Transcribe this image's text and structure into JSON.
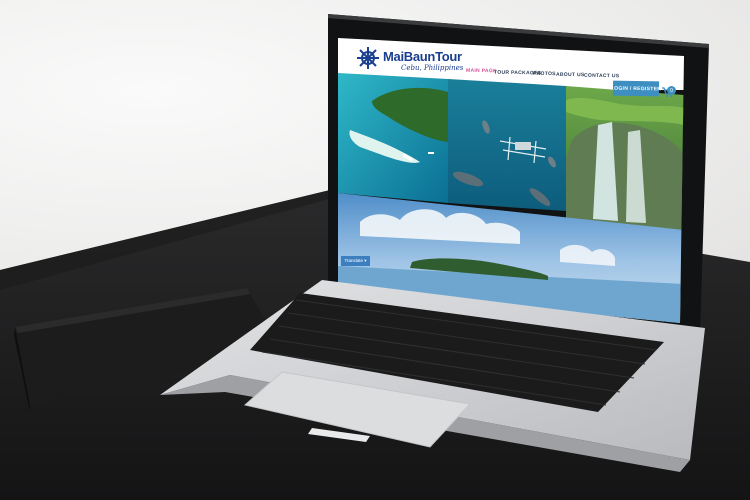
{
  "site": {
    "brand": "MaiBaunTour",
    "tagline": "Cebu, Philippines",
    "nav": {
      "main_page": "MAIN PAGE",
      "tour_packages": "TOUR PACKAGES",
      "photos": "PHOTOS",
      "about_us": "ABOUT US",
      "contact_us": "CONTACT US"
    },
    "login_label": "LOGIN / REGISTER",
    "cart_count": "0",
    "translate_label": "Translate ▾"
  },
  "colors": {
    "brand_blue": "#1b3f8f",
    "active_nav": "#d44f9a",
    "button_blue": "#3c8fc0"
  },
  "icons": [
    "ship-wheel-icon",
    "cart-icon"
  ]
}
